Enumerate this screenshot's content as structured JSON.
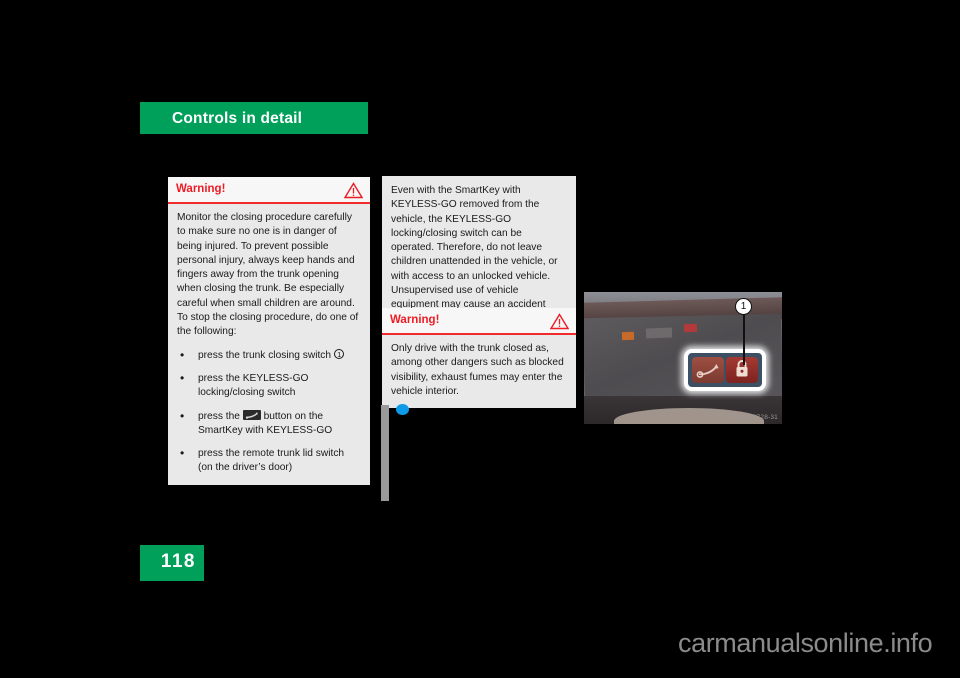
{
  "header": {
    "chapter_title": "Controls in detail",
    "green": "#00a05a"
  },
  "page_footer": {
    "page_number": "118"
  },
  "left_column": {
    "warning_box": {
      "label": "Warning!",
      "icon": "warning-triangle-icon",
      "accent_color": "#ee1c25",
      "body": "Monitor the closing procedure carefully to make sure no one is in danger of being injured. To prevent possible personal injury, always keep hands and fingers away from the trunk opening when closing the trunk. Be especially careful when small children are around. To stop the closing procedure, do one of the following:",
      "bullets": [
        {
          "text_before": "press the trunk closing switch",
          "inline_marker": "1",
          "inline_marker_type": "circled-number",
          "text_after": ""
        },
        {
          "text_before": "press the KEYLESS-GO locking/closing switch",
          "inline_marker": "",
          "inline_marker_type": "",
          "text_after": ""
        },
        {
          "text_before": "press the",
          "inline_marker": "trunk-button-icon",
          "inline_marker_type": "button-glyph",
          "text_after": "button on the SmartKey with KEYLESS-GO"
        },
        {
          "text_before": "press the remote trunk lid switch (on the driver’s door)",
          "inline_marker": "",
          "inline_marker_type": "",
          "text_after": ""
        }
      ]
    }
  },
  "right_column": {
    "note_block": {
      "body": "Even with the SmartKey with KEYLESS-GO removed from the vehicle, the KEYLESS-GO locking/closing switch can be operated. Therefore, do not leave children unattended in the vehicle, or with access to an unlocked vehicle. Unsupervised use of vehicle equipment may cause an accident and/or serious personal injury."
    },
    "warning_box": {
      "label": "Warning!",
      "icon": "warning-triangle-icon",
      "accent_color": "#ee1c25",
      "body": "Only drive with the trunk closed as, among other dangers such as blocked visibility, exhaust fumes may enter the vehicle interior."
    }
  },
  "figure": {
    "callout_number": "1",
    "photo_credit": "P60.20-2728-31",
    "description": "trunk-interior-switch-panel"
  },
  "watermark": {
    "text": "carmanualsonline.info"
  }
}
